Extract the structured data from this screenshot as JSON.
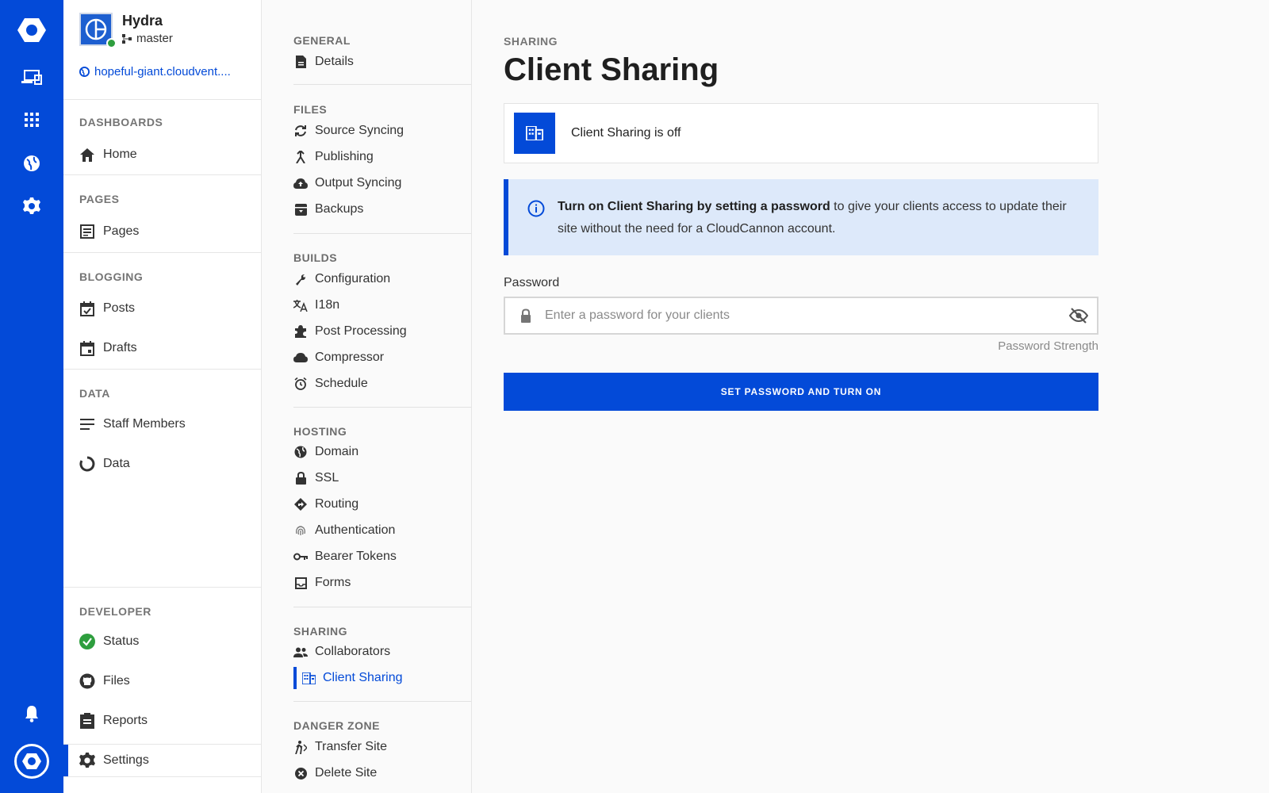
{
  "rail": {
    "items": [
      {
        "icon": "cloudcannon-logo-icon"
      },
      {
        "icon": "devices-icon"
      },
      {
        "icon": "apps-grid-icon"
      },
      {
        "icon": "globe-icon"
      },
      {
        "icon": "gear-icon"
      },
      {
        "icon": "bell-icon"
      },
      {
        "icon": "user-avatar-icon"
      }
    ]
  },
  "site": {
    "name": "Hydra",
    "branch": "master",
    "url": "hopeful-giant.cloudvent...."
  },
  "sidebar": {
    "sections": [
      {
        "heading": "DASHBOARDS",
        "items": [
          {
            "label": "Home",
            "icon": "home-icon"
          }
        ]
      },
      {
        "heading": "PAGES",
        "items": [
          {
            "label": "Pages",
            "icon": "pages-icon"
          }
        ]
      },
      {
        "heading": "BLOGGING",
        "items": [
          {
            "label": "Posts",
            "icon": "calendar-check-icon"
          },
          {
            "label": "Drafts",
            "icon": "calendar-icon"
          }
        ]
      },
      {
        "heading": "DATA",
        "items": [
          {
            "label": "Staff Members",
            "icon": "list-icon"
          },
          {
            "label": "Data",
            "icon": "spinner-icon"
          }
        ]
      },
      {
        "heading": "DEVELOPER",
        "items": [
          {
            "label": "Status",
            "icon": "check-circle-icon"
          },
          {
            "label": "Files",
            "icon": "github-icon"
          },
          {
            "label": "Reports",
            "icon": "clipboard-icon"
          },
          {
            "label": "Settings",
            "icon": "gear-icon"
          }
        ]
      }
    ]
  },
  "settings_nav": {
    "sections": [
      {
        "heading": "GENERAL",
        "items": [
          "Details"
        ]
      },
      {
        "heading": "FILES",
        "items": [
          "Source Syncing",
          "Publishing",
          "Output Syncing",
          "Backups"
        ]
      },
      {
        "heading": "BUILDS",
        "items": [
          "Configuration",
          "I18n",
          "Post Processing",
          "Compressor",
          "Schedule"
        ]
      },
      {
        "heading": "HOSTING",
        "items": [
          "Domain",
          "SSL",
          "Routing",
          "Authentication",
          "Bearer Tokens",
          "Forms"
        ]
      },
      {
        "heading": "SHARING",
        "items": [
          "Collaborators",
          "Client Sharing"
        ]
      },
      {
        "heading": "DANGER ZONE",
        "items": [
          "Transfer Site",
          "Delete Site"
        ]
      }
    ],
    "active": "Client Sharing"
  },
  "main": {
    "kicker": "SHARING",
    "title": "Client Sharing",
    "status_text": "Client Sharing is off",
    "info_bold": "Turn on Client Sharing by setting a password",
    "info_rest": " to give your clients access to update their site without the need for a CloudCannon account.",
    "password_label": "Password",
    "password_placeholder": "Enter a password for your clients",
    "password_value": "",
    "password_strength": "Password Strength",
    "submit_label": "SET PASSWORD AND TURN ON"
  },
  "colors": {
    "brand": "#034ad8",
    "info_bg": "#dde9fa",
    "success": "#2e9e3e"
  }
}
